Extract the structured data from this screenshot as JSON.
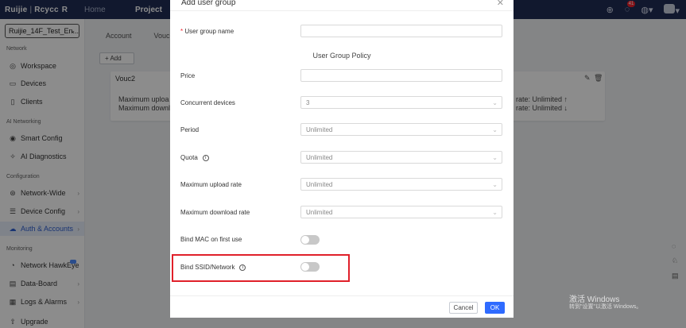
{
  "topbar": {
    "brand": "Ruijie",
    "brand_sub": "Rcycc",
    "brand_glyph": "R",
    "nav": [
      "Home",
      "Project"
    ],
    "notification_count": "41"
  },
  "sidebar": {
    "project": "Ruijie_14F_Test_En...",
    "sections": {
      "network": "Network",
      "ai": "AI Networking",
      "config": "Configuration",
      "monitoring": "Monitoring"
    },
    "items": {
      "workspace": "Workspace",
      "devices": "Devices",
      "clients": "Clients",
      "smart_config": "Smart Config",
      "ai_diag": "AI Diagnostics",
      "network_wide": "Network-Wide",
      "device_config": "Device Config",
      "auth": "Auth & Accounts",
      "hawkeye": "Network HawkEye",
      "data_board": "Data-Board",
      "logs": "Logs & Alarms",
      "upgrade": "Upgrade"
    }
  },
  "content": {
    "tabs": [
      "Account",
      "Vouc"
    ],
    "add_label": "+ Add",
    "card": {
      "title": "Vouc2",
      "left_line1": "Maximum uploa",
      "left_line2": "Maximum downl",
      "right_line1": "rate:  Unlimited ↑",
      "right_line2": "rate:  Unlimited ↓"
    }
  },
  "modal": {
    "title": "Add user group",
    "group_name_label": "User group name",
    "group_name_value": "",
    "policy_title": "User Group Policy",
    "price_label": "Price",
    "price_value": "",
    "concurrent_label": "Concurrent devices",
    "concurrent_value": "3",
    "period_label": "Period",
    "period_value": "Unlimited",
    "quota_label": "Quota",
    "quota_value": "Unlimited",
    "upload_label": "Maximum upload rate",
    "upload_value": "Unlimited",
    "download_label": "Maximum download rate",
    "download_value": "Unlimited",
    "bind_mac_label": "Bind MAC on first use",
    "bind_mac_on": false,
    "bind_ssid_label": "Bind SSID/Network",
    "bind_ssid_on": false,
    "cancel": "Cancel",
    "ok": "OK"
  },
  "watermark": {
    "line1": "激活 Windows",
    "line2": "转到\"设置\"以激活 Windows。"
  },
  "colors": {
    "topbar": "#1f2d55",
    "primary": "#2f6bff",
    "highlight": "#e0202a",
    "active_item_bg": "#e8eefb"
  }
}
